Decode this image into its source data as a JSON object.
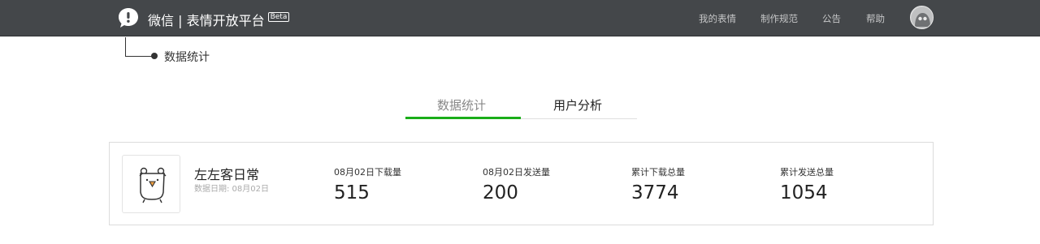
{
  "header": {
    "brand_name": "微信 | 表情开放平台",
    "beta_badge": "Beta",
    "nav": [
      "我的表情",
      "制作规范",
      "公告",
      "帮助"
    ],
    "colors": {
      "bar": "#44474a",
      "accent": "#1aad19"
    }
  },
  "breadcrumb": {
    "label": "数据统计"
  },
  "tabs": [
    {
      "label": "数据统计",
      "active": true
    },
    {
      "label": "用户分析",
      "active": false
    }
  ],
  "card": {
    "pack_name": "左左客日常",
    "date_text": "数据日期:  08月02日",
    "stats": [
      {
        "label": "08月02日下载量",
        "value": "515"
      },
      {
        "label": "08月02日发送量",
        "value": "200"
      },
      {
        "label": "累计下载总量",
        "value": "3774"
      },
      {
        "label": "累计发送总量",
        "value": "1054"
      }
    ]
  }
}
